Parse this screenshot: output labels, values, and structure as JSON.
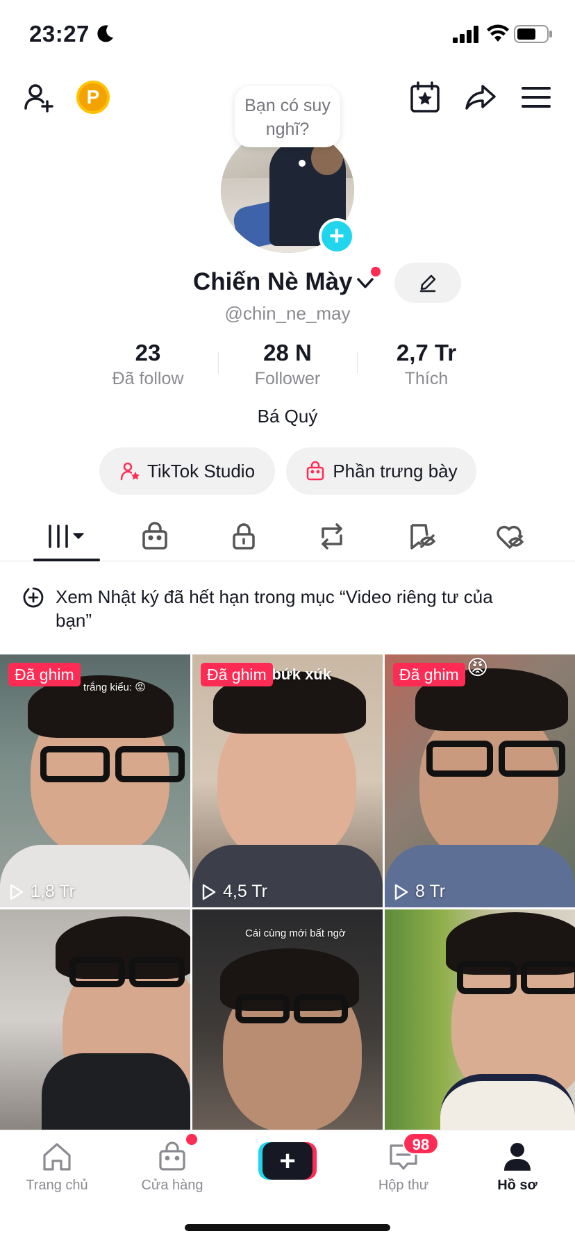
{
  "status": {
    "time": "23:27"
  },
  "header": {
    "add_friend_icon": "person-add-icon",
    "coin_letter": "P",
    "thought_bubble": "Bạn có suy nghĩ?",
    "calendar_icon": "calendar-star-icon",
    "share_icon": "share-arrow-icon",
    "menu_icon": "hamburger-menu-icon"
  },
  "profile": {
    "name": "Chiến Nè Mày",
    "username": "@chin_ne_may",
    "bio": "Bá Quý",
    "stats": [
      {
        "value": "23",
        "label": "Đã follow"
      },
      {
        "value": "28 N",
        "label": "Follower"
      },
      {
        "value": "2,7 Tr",
        "label": "Thích"
      }
    ]
  },
  "actions": {
    "studio_label": "TikTok Studio",
    "showcase_label": "Phần trưng bày"
  },
  "tabs": [
    {
      "id": "videos",
      "icon": "grid-bars-icon",
      "active": true
    },
    {
      "id": "shop",
      "icon": "shopping-bag-icon"
    },
    {
      "id": "private",
      "icon": "lock-icon"
    },
    {
      "id": "reposts",
      "icon": "repost-icon"
    },
    {
      "id": "favorites",
      "icon": "bookmark-hidden-icon"
    },
    {
      "id": "liked",
      "icon": "heart-hidden-icon"
    }
  ],
  "notice": {
    "text": "Xem Nhật ký đã hết hạn trong mục “Video riêng tư của bạn”"
  },
  "videos": [
    {
      "pinned_label": "Đã ghim",
      "views": "1,8 Tr",
      "overlay": "trắng kiểu: 😡"
    },
    {
      "pinned_label": "Đã ghim",
      "views": "4,5 Tr",
      "overlay": "c bứk xúk"
    },
    {
      "pinned_label": "Đã ghim",
      "views": "8 Tr",
      "overlay": "😡"
    },
    {
      "pinned_label": "",
      "views": "",
      "overlay": ""
    },
    {
      "pinned_label": "",
      "views": "",
      "overlay": "Cái cùng mới bất ngờ"
    },
    {
      "pinned_label": "",
      "views": "",
      "overlay": ""
    }
  ],
  "bottom_nav": [
    {
      "label": "Trang chủ",
      "icon": "home-icon"
    },
    {
      "label": "Cửa hàng",
      "icon": "shop-bag-icon"
    },
    {
      "label": "",
      "icon": "create-plus-icon"
    },
    {
      "label": "Hộp thư",
      "icon": "inbox-icon",
      "badge": "98"
    },
    {
      "label": "Hồ sơ",
      "icon": "profile-icon",
      "active": true
    }
  ],
  "colors": {
    "accent": "#fe2c55",
    "cyan": "#20d5ec",
    "text": "#161823",
    "muted": "#8a8b91"
  }
}
